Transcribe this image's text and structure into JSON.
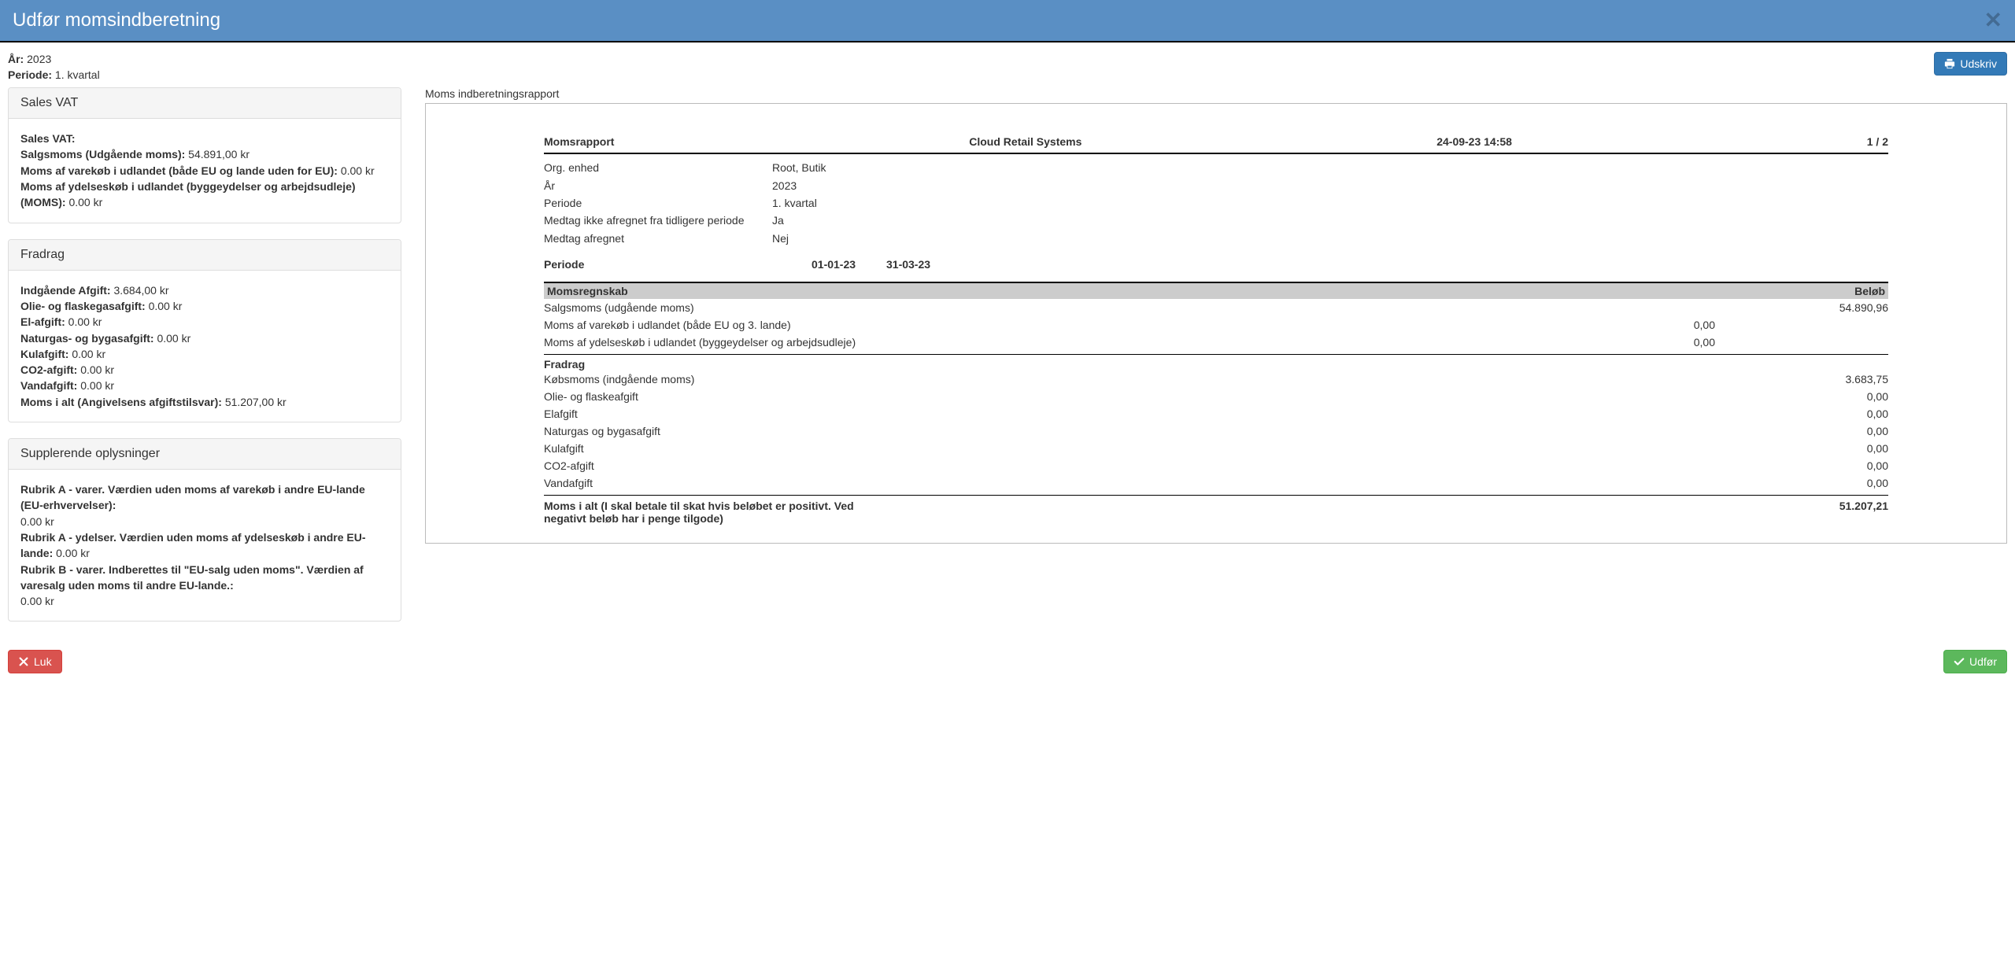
{
  "header": {
    "title": "Udfør momsindberetning"
  },
  "meta": {
    "year_label": "År:",
    "year_value": "2023",
    "period_label": "Periode:",
    "period_value": "1. kvartal"
  },
  "buttons": {
    "print": "Udskriv",
    "close": "Luk",
    "execute": "Udfør"
  },
  "panels": {
    "sales": {
      "title": "Sales VAT",
      "lines": [
        {
          "label": "Sales VAT:",
          "value": ""
        },
        {
          "label": "Salgsmoms (Udgående moms):",
          "value": "54.891,00 kr"
        },
        {
          "label": "Moms af varekøb i udlandet (både EU og lande uden for EU):",
          "value": "0.00 kr"
        },
        {
          "label": "Moms af ydelseskøb i udlandet (byggeydelser og arbejdsudleje) (MOMS):",
          "value": "0.00 kr"
        }
      ]
    },
    "deductions": {
      "title": "Fradrag",
      "lines": [
        {
          "label": "Indgående Afgift:",
          "value": "3.684,00 kr"
        },
        {
          "label": "Olie- og flaskegasafgift:",
          "value": "0.00 kr"
        },
        {
          "label": "El-afgift:",
          "value": "0.00 kr"
        },
        {
          "label": "Naturgas- og bygasafgift:",
          "value": "0.00 kr"
        },
        {
          "label": "Kulafgift:",
          "value": "0.00 kr"
        },
        {
          "label": "CO2-afgift:",
          "value": "0.00 kr"
        },
        {
          "label": "Vandafgift:",
          "value": "0.00 kr"
        },
        {
          "label": "Moms i alt (Angivelsens afgiftstilsvar):",
          "value": "51.207,00 kr"
        }
      ]
    },
    "supp": {
      "title": "Supplerende oplysninger",
      "lines": [
        {
          "label": "Rubrik A - varer. Værdien uden moms af varekøb i andre EU-lande (EU-erhvervelser):",
          "value": ""
        },
        {
          "label": "",
          "value": "0.00 kr"
        },
        {
          "label": "Rubrik A - ydelser. Værdien uden moms af ydelseskøb i andre EU-lande:",
          "value": "0.00 kr"
        },
        {
          "label": "Rubrik B - varer. Indberettes til \"EU-salg uden moms\". Værdien af varesalg uden moms til andre EU-lande.:",
          "value": ""
        },
        {
          "label": "",
          "value": "0.00 kr"
        }
      ]
    }
  },
  "report": {
    "caption": "Moms indberetningsrapport",
    "head": {
      "title": "Momsrapport",
      "company": "Cloud Retail Systems",
      "timestamp": "24-09-23 14:58",
      "page": "1 / 2"
    },
    "meta": [
      {
        "k": "Org. enhed",
        "v": "Root, Butik"
      },
      {
        "k": "År",
        "v": "2023"
      },
      {
        "k": "Periode",
        "v": "1. kvartal"
      },
      {
        "k": "Medtag ikke afregnet fra tidligere periode",
        "v": "Ja"
      },
      {
        "k": "Medtag afregnet",
        "v": "Nej"
      }
    ],
    "period": {
      "label": "Periode",
      "from": "01-01-23",
      "to": "31-03-23"
    },
    "section": {
      "head_left": "Momsregnskab",
      "head_right": "Beløb"
    },
    "rows_top": [
      {
        "lbl": "Salgsmoms (udgående moms)",
        "mid": "",
        "val": "54.890,96"
      },
      {
        "lbl": "Moms af varekøb i udlandet (både EU og 3. lande)",
        "mid": "0,00",
        "val": ""
      },
      {
        "lbl": "Moms af ydelseskøb i udlandet (byggeydelser og arbejdsudleje)",
        "mid": "0,00",
        "val": ""
      }
    ],
    "fradrag_label": "Fradrag",
    "rows_bottom": [
      {
        "lbl": "Købsmoms (indgående moms)",
        "val": "3.683,75"
      },
      {
        "lbl": "Olie- og flaskeafgift",
        "val": "0,00"
      },
      {
        "lbl": "Elafgift",
        "val": "0,00"
      },
      {
        "lbl": "Naturgas og bygasafgift",
        "val": "0,00"
      },
      {
        "lbl": "Kulafgift",
        "val": "0,00"
      },
      {
        "lbl": "CO2-afgift",
        "val": "0,00"
      },
      {
        "lbl": "Vandafgift",
        "val": "0,00"
      }
    ],
    "total": {
      "lbl": "Moms i alt (I skal betale til skat hvis beløbet er positivt. Ved negativt beløb har i penge tilgode)",
      "val": "51.207,21"
    }
  }
}
